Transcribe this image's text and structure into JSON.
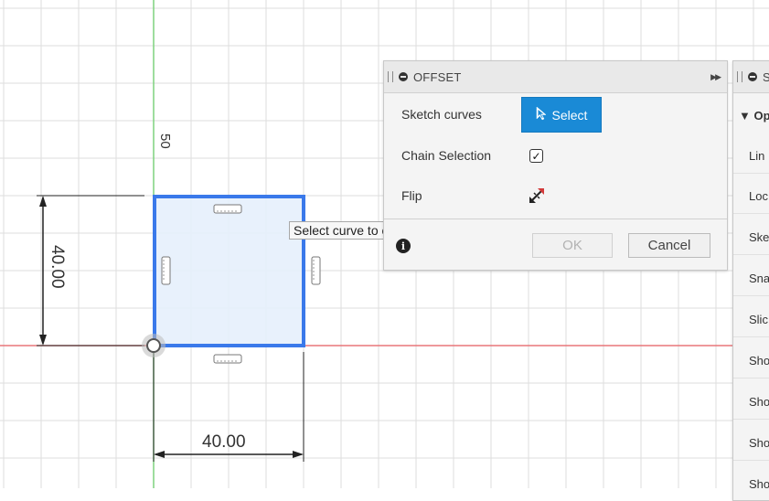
{
  "offset_panel": {
    "title": "OFFSET",
    "expand_icon": "double-chevron-right",
    "rows": {
      "sketch_curves_label": "Sketch curves",
      "select_button_label": "Select",
      "chain_selection_label": "Chain Selection",
      "chain_selection_checked": true,
      "flip_label": "Flip"
    },
    "ok_label": "OK",
    "cancel_label": "Cancel",
    "ok_enabled": false
  },
  "tooltip": "Select curve to offset",
  "side_panel": {
    "title_partial": "S",
    "section": "Op",
    "items": [
      "Lin",
      "Loc",
      "Ske",
      "Sna",
      "Slic",
      "Sho",
      "Sho",
      "Sho",
      "Sho"
    ]
  },
  "sketch": {
    "vertical_dimension": "40.00",
    "horizontal_dimension": "40.00",
    "axis_label": "50"
  },
  "colors": {
    "accent": "#1a8ad6",
    "selection_blue": "#3a79ea",
    "x_axis": "#e8777a",
    "y_axis": "#7fd27f",
    "grid": "#dcdcdc"
  }
}
